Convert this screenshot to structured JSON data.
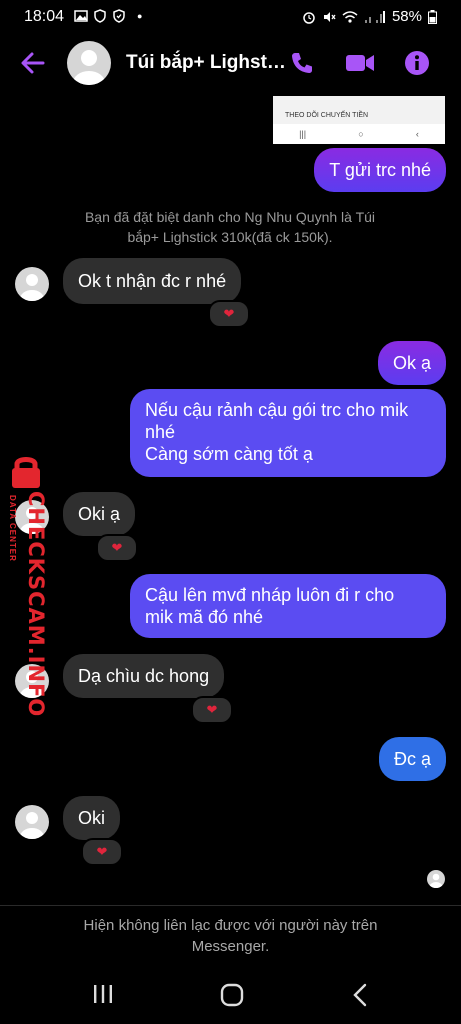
{
  "status_bar": {
    "time": "18:04",
    "battery": "58%"
  },
  "header": {
    "contact_name": "Túi bắp+ Lighst…"
  },
  "colors": {
    "accent": "#8a2be2",
    "outgoing_blue": "#2f6fe6",
    "incoming": "#2f2f2f",
    "heart": "#e0253c"
  },
  "shared_image": {
    "caption": "THEO DÕI CHUYẾN TIỀN"
  },
  "messages": [
    {
      "text": "T gửi trc nhé"
    },
    {
      "text": "Bạn đã đặt biệt danh cho Ng Nhu Quynh là Túi bắp+ Lighstick 310k(đã ck 150k)."
    },
    {
      "text": "Ok t nhận đc r nhé",
      "reaction": "❤"
    },
    {
      "text": "Ok ạ"
    },
    {
      "line1": "Nếu cậu rảnh cậu gói trc cho mik",
      "line2": "nhé",
      "line3": "Càng sớm càng tốt ạ"
    },
    {
      "text": "Oki ạ",
      "reaction": "❤"
    },
    {
      "line1": "Cậu lên mvđ nháp luôn đi r cho",
      "line2": "mik mã đó nhé"
    },
    {
      "text": "Dạ chìu dc hong",
      "reaction": "❤"
    },
    {
      "text": "Đc ạ"
    },
    {
      "text": "Oki",
      "reaction": "❤"
    }
  ],
  "footer": {
    "line1": "Hiện không liên lạc được với người này trên",
    "line2": "Messenger."
  },
  "watermark": {
    "brand": "CHECKSCAM.INFO",
    "sub": "DATA CENTER"
  }
}
